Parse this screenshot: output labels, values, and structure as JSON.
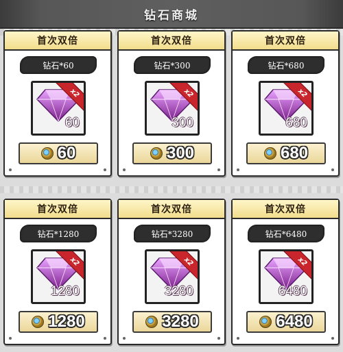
{
  "header": {
    "title": "钻石商城"
  },
  "ribbon_label": "x2",
  "colors": {
    "banner": "#555555",
    "card_head": "#f2dd8c",
    "ribbon": "#c9252c",
    "gem_top": "#e9a3ff",
    "gem_bottom": "#7a1f8a"
  },
  "icons": {
    "gem": "diamond-icon",
    "currency": "coin-icon"
  },
  "cards": [
    {
      "badge": "首次双倍",
      "name": "钻石*60",
      "amount": "60",
      "price": "60"
    },
    {
      "badge": "首次双倍",
      "name": "钻石*300",
      "amount": "300",
      "price": "300"
    },
    {
      "badge": "首次双倍",
      "name": "钻石*680",
      "amount": "680",
      "price": "680"
    },
    {
      "badge": "首次双倍",
      "name": "钻石*1280",
      "amount": "1280",
      "price": "1280"
    },
    {
      "badge": "首次双倍",
      "name": "钻石*3280",
      "amount": "3280",
      "price": "3280"
    },
    {
      "badge": "首次双倍",
      "name": "钻石*6480",
      "amount": "6480",
      "price": "6480"
    }
  ]
}
